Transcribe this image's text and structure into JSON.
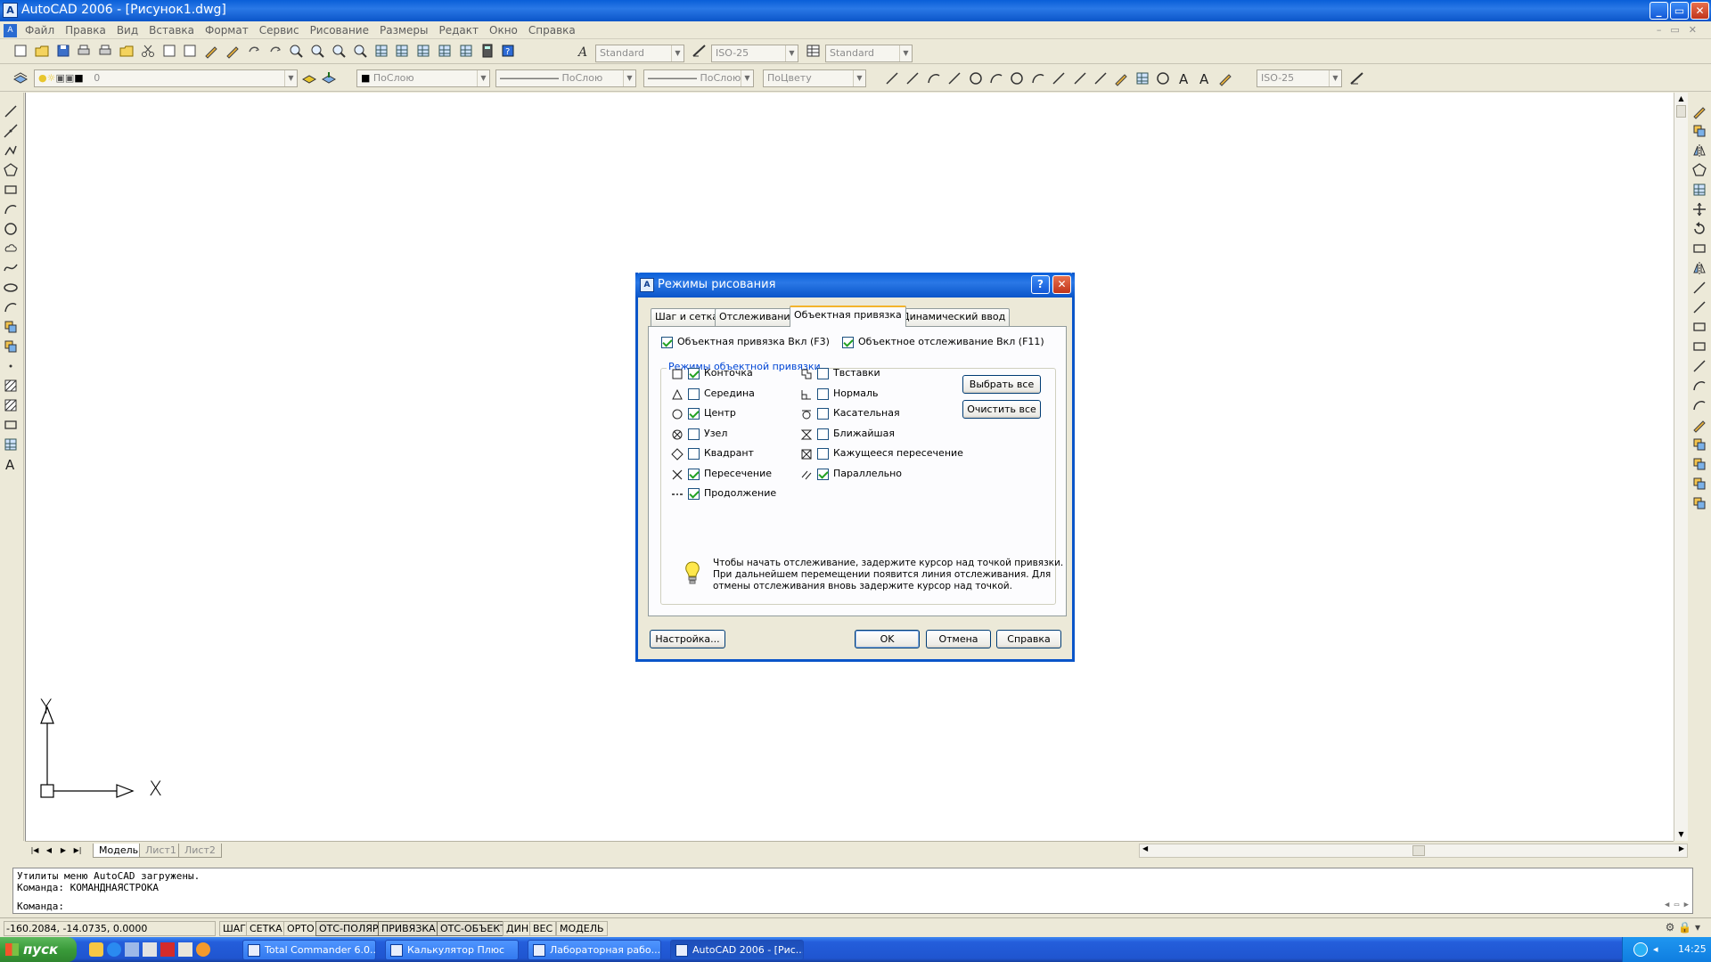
{
  "window": {
    "title": "AutoCAD 2006 - [Рисунок1.dwg]",
    "controls": [
      "_",
      "▭",
      "✕"
    ]
  },
  "menu": [
    "Файл",
    "Правка",
    "Вид",
    "Вставка",
    "Формат",
    "Сервис",
    "Рисование",
    "Размеры",
    "Редакт",
    "Окно",
    "Справка"
  ],
  "toolbars": {
    "text_style": "Standard",
    "dim_style": "ISO-25",
    "table_style": "Standard",
    "layer": "0",
    "color": "ПоСлою",
    "linetype": "ПоСлою",
    "lineweight": "ПоСлою",
    "plotstyle": "ПоЦвету",
    "dim_style2": "ISO-25"
  },
  "ucs": {
    "y_label": "Y",
    "x_label": "X"
  },
  "layout_tabs": [
    "Модель",
    "Лист1",
    "Лист2"
  ],
  "command_line": {
    "history": [
      "Утилиты меню AutoCAD загружены.",
      "Команда: КОМАНДНАЯСТРОКА"
    ],
    "prompt": "Команда:"
  },
  "status": {
    "coords": "-160.2084, -14.0735, 0.0000",
    "buttons": [
      "ШАГ",
      "СЕТКА",
      "ОРТО",
      "ОТС-ПОЛЯР",
      "ПРИВЯЗКА",
      "ОТС-ОБЪЕКТ",
      "ДИН",
      "ВЕС",
      "МОДЕЛЬ"
    ],
    "active": [
      "ОТС-ПОЛЯР",
      "ПРИВЯЗКА",
      "ОТС-ОБЪЕКТ"
    ]
  },
  "taskbar": {
    "start": "пуск",
    "tasks": [
      "Total Commander 6.0...",
      "Калькулятор Плюс",
      "Лабораторная рабо...",
      "AutoCAD 2006 - [Рис..."
    ],
    "lang": "EN",
    "clock": "14:25"
  },
  "dialog": {
    "title": "Режимы рисования",
    "help_btn": "?",
    "close_btn": "✕",
    "tabs": [
      "Шаг и сетка",
      "Отслеживание",
      "Объектная привязка",
      "Динамический ввод"
    ],
    "active_tab": "Объектная привязка",
    "osnap_on": {
      "label": "Объектная привязка Вкл (F3)",
      "checked": true
    },
    "otrack_on": {
      "label": "Объектное отслеживание Вкл (F11)",
      "checked": true
    },
    "group_title": "Режимы объектной привязки",
    "modes_left": [
      {
        "label": "Конточка",
        "checked": true,
        "icon": "square-endpoint-icon"
      },
      {
        "label": "Середина",
        "checked": false,
        "icon": "triangle-midpoint-icon"
      },
      {
        "label": "Центр",
        "checked": true,
        "icon": "circle-center-icon"
      },
      {
        "label": "Узел",
        "checked": false,
        "icon": "node-icon"
      },
      {
        "label": "Квадрант",
        "checked": false,
        "icon": "diamond-quadrant-icon"
      },
      {
        "label": "Пересечение",
        "checked": true,
        "icon": "cross-intersection-icon"
      },
      {
        "label": "Продолжение",
        "checked": true,
        "icon": "extension-icon"
      }
    ],
    "modes_right": [
      {
        "label": "Твставки",
        "checked": false,
        "icon": "insertion-icon"
      },
      {
        "label": "Нормаль",
        "checked": false,
        "icon": "perpendicular-icon"
      },
      {
        "label": "Касательная",
        "checked": false,
        "icon": "tangent-icon"
      },
      {
        "label": "Ближайшая",
        "checked": false,
        "icon": "nearest-icon"
      },
      {
        "label": "Кажущееся пересечение",
        "checked": false,
        "icon": "apparent-intersection-icon"
      },
      {
        "label": "Параллельно",
        "checked": true,
        "icon": "parallel-icon"
      }
    ],
    "select_all": "Выбрать все",
    "clear_all": "Очистить все",
    "hint": [
      "Чтобы начать отслеживание, задержите курсор над точкой привязки.",
      "При дальнейшем перемещении появится линия отслеживания. Для",
      "отмены отслеживания вновь задержите курсор над точкой."
    ],
    "settings_btn": "Настройка...",
    "ok_btn": "OK",
    "cancel_btn": "Отмена",
    "help_button": "Справка"
  }
}
